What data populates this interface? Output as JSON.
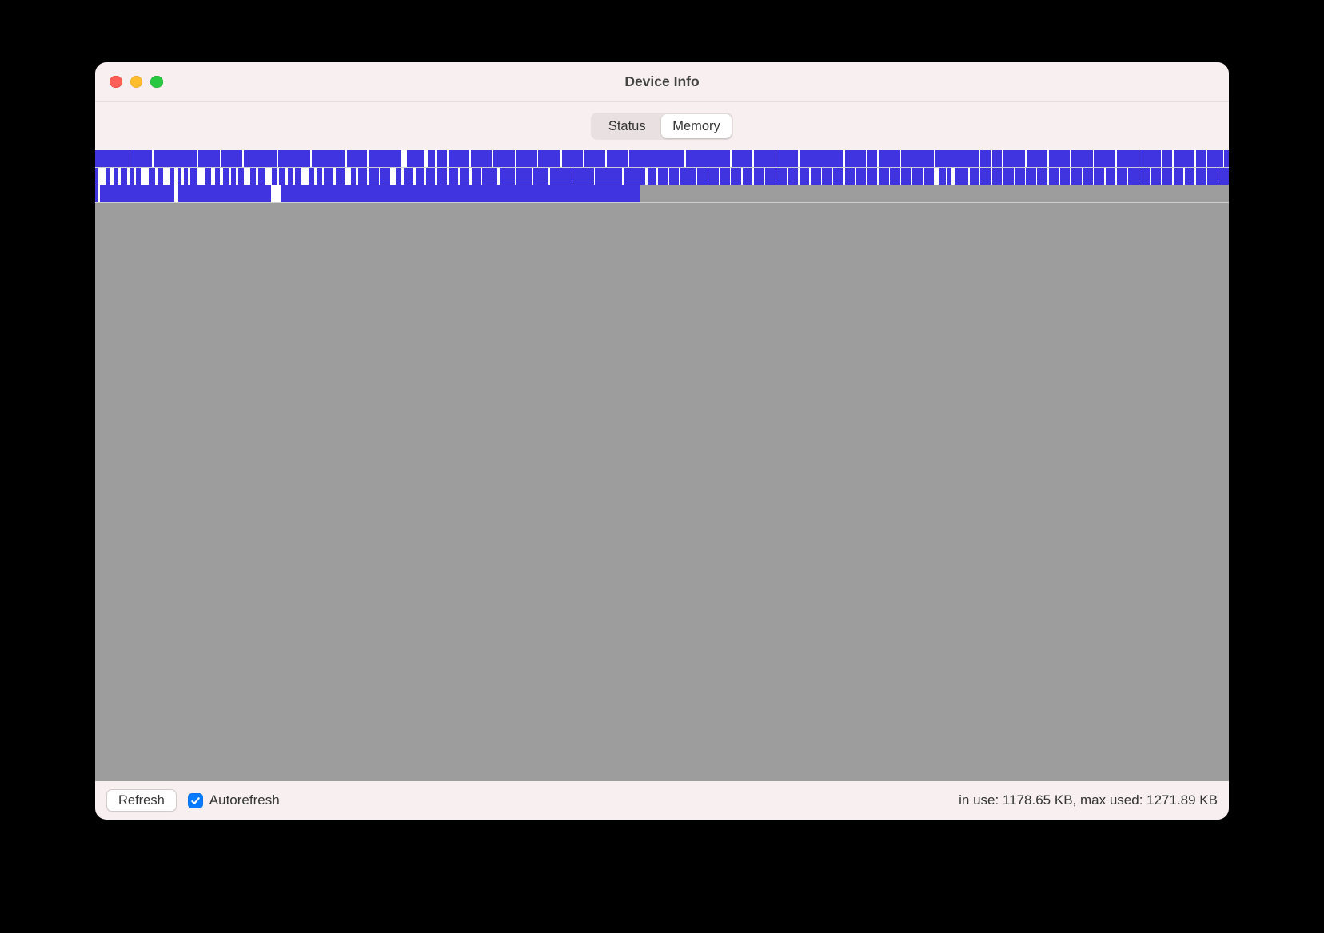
{
  "window": {
    "title": "Device Info"
  },
  "tabs": [
    {
      "label": "Status",
      "selected": false
    },
    {
      "label": "Memory",
      "selected": true
    }
  ],
  "footer": {
    "refresh_label": "Refresh",
    "autorefresh_label": "Autorefresh",
    "autorefresh_checked": true,
    "stats_text": "in use: 1178.65 KB, max used: 1271.89 KB",
    "in_use_kb": 1178.65,
    "max_used_kb": 1271.89
  },
  "memory_map": {
    "color_used": "#4033e0",
    "color_free": "#ffffff",
    "color_unmapped": "#9d9d9d",
    "rows": [
      {
        "fill_percent": 100,
        "filled": true,
        "gaps": [
          {
            "p": 3,
            "w": 0.12
          },
          {
            "p": 5,
            "w": 0.14
          },
          {
            "p": 9,
            "w": 0.1
          },
          {
            "p": 11,
            "w": 0.1
          },
          {
            "p": 13,
            "w": 0.12
          },
          {
            "p": 16,
            "w": 0.15
          },
          {
            "p": 19,
            "w": 0.12
          },
          {
            "p": 22,
            "w": 0.18
          },
          {
            "p": 24,
            "w": 0.1
          },
          {
            "p": 27,
            "w": 0.5
          },
          {
            "p": 29,
            "w": 0.35
          },
          {
            "p": 30,
            "w": 0.14
          },
          {
            "p": 31,
            "w": 0.18
          },
          {
            "p": 33,
            "w": 0.12
          },
          {
            "p": 35,
            "w": 0.12
          },
          {
            "p": 37,
            "w": 0.1
          },
          {
            "p": 39,
            "w": 0.1
          },
          {
            "p": 41,
            "w": 0.16
          },
          {
            "p": 43,
            "w": 0.14
          },
          {
            "p": 45,
            "w": 0.1
          },
          {
            "p": 47,
            "w": 0.12
          },
          {
            "p": 52,
            "w": 0.1
          },
          {
            "p": 56,
            "w": 0.16
          },
          {
            "p": 58,
            "w": 0.1
          },
          {
            "p": 60,
            "w": 0.1
          },
          {
            "p": 62,
            "w": 0.12
          },
          {
            "p": 66,
            "w": 0.12
          },
          {
            "p": 68,
            "w": 0.1
          },
          {
            "p": 69,
            "w": 0.12
          },
          {
            "p": 71,
            "w": 0.1
          },
          {
            "p": 74,
            "w": 0.1
          },
          {
            "p": 78,
            "w": 0.1
          },
          {
            "p": 79,
            "w": 0.1
          },
          {
            "p": 80,
            "w": 0.1
          },
          {
            "p": 82,
            "w": 0.15
          },
          {
            "p": 84,
            "w": 0.12
          },
          {
            "p": 86,
            "w": 0.12
          },
          {
            "p": 88,
            "w": 0.1
          },
          {
            "p": 90,
            "w": 0.1
          },
          {
            "p": 92,
            "w": 0.1
          },
          {
            "p": 94,
            "w": 0.12
          },
          {
            "p": 95,
            "w": 0.1
          },
          {
            "p": 97,
            "w": 0.12
          },
          {
            "p": 98,
            "w": 0.12
          },
          {
            "p": 99.5,
            "w": 0.1
          }
        ]
      },
      {
        "fill_percent": 100,
        "filled": true,
        "gaps": [
          {
            "p": 0.3,
            "w": 0.6
          },
          {
            "p": 1.3,
            "w": 0.3
          },
          {
            "p": 2,
            "w": 0.25
          },
          {
            "p": 2.8,
            "w": 0.2
          },
          {
            "p": 3.4,
            "w": 0.18
          },
          {
            "p": 4.0,
            "w": 0.7
          },
          {
            "p": 5.3,
            "w": 0.25
          },
          {
            "p": 6.0,
            "w": 0.6
          },
          {
            "p": 7.0,
            "w": 0.3
          },
          {
            "p": 7.6,
            "w": 0.2
          },
          {
            "p": 8.2,
            "w": 0.2
          },
          {
            "p": 9.0,
            "w": 0.7
          },
          {
            "p": 10.2,
            "w": 0.4
          },
          {
            "p": 11.0,
            "w": 0.25
          },
          {
            "p": 11.8,
            "w": 0.2
          },
          {
            "p": 12.4,
            "w": 0.2
          },
          {
            "p": 13.1,
            "w": 0.6
          },
          {
            "p": 14.2,
            "w": 0.2
          },
          {
            "p": 15.0,
            "w": 0.6
          },
          {
            "p": 16.0,
            "w": 0.25
          },
          {
            "p": 16.8,
            "w": 0.2
          },
          {
            "p": 17.4,
            "w": 0.2
          },
          {
            "p": 18.2,
            "w": 0.6
          },
          {
            "p": 19.3,
            "w": 0.2
          },
          {
            "p": 20.0,
            "w": 0.2
          },
          {
            "p": 21.0,
            "w": 0.25
          },
          {
            "p": 22.0,
            "w": 0.6
          },
          {
            "p": 23.0,
            "w": 0.2
          },
          {
            "p": 24.0,
            "w": 0.2
          },
          {
            "p": 25.0,
            "w": 0.14
          },
          {
            "p": 26.0,
            "w": 0.5
          },
          {
            "p": 27.0,
            "w": 0.2
          },
          {
            "p": 28.0,
            "w": 0.25
          },
          {
            "p": 29.0,
            "w": 0.2
          },
          {
            "p": 30.0,
            "w": 0.2
          },
          {
            "p": 31.0,
            "w": 0.2
          },
          {
            "p": 32.0,
            "w": 0.18
          },
          {
            "p": 33.0,
            "w": 0.2
          },
          {
            "p": 34.0,
            "w": 0.15
          },
          {
            "p": 35.5,
            "w": 0.15
          },
          {
            "p": 37.0,
            "w": 0.12
          },
          {
            "p": 38.5,
            "w": 0.12
          },
          {
            "p": 40.0,
            "w": 0.1
          },
          {
            "p": 42.0,
            "w": 0.12
          },
          {
            "p": 44.0,
            "w": 0.1
          },
          {
            "p": 46.5,
            "w": 0.1
          },
          {
            "p": 48.5,
            "w": 0.25
          },
          {
            "p": 49.5,
            "w": 0.12
          },
          {
            "p": 50.5,
            "w": 0.12
          },
          {
            "p": 51.5,
            "w": 0.12
          },
          {
            "p": 53.0,
            "w": 0.12
          },
          {
            "p": 54.0,
            "w": 0.1
          },
          {
            "p": 55.0,
            "w": 0.12
          },
          {
            "p": 56.0,
            "w": 0.1
          },
          {
            "p": 57.0,
            "w": 0.12
          },
          {
            "p": 58.0,
            "w": 0.1
          },
          {
            "p": 59.0,
            "w": 0.1
          },
          {
            "p": 60.0,
            "w": 0.12
          },
          {
            "p": 61.0,
            "w": 0.12
          },
          {
            "p": 62.0,
            "w": 0.1
          },
          {
            "p": 63.0,
            "w": 0.12
          },
          {
            "p": 64.0,
            "w": 0.12
          },
          {
            "p": 65.0,
            "w": 0.1
          },
          {
            "p": 66.0,
            "w": 0.12
          },
          {
            "p": 67.0,
            "w": 0.12
          },
          {
            "p": 68.0,
            "w": 0.12
          },
          {
            "p": 69.0,
            "w": 0.1
          },
          {
            "p": 70.0,
            "w": 0.1
          },
          {
            "p": 71.0,
            "w": 0.12
          },
          {
            "p": 72.0,
            "w": 0.1
          },
          {
            "p": 73.0,
            "w": 0.12
          },
          {
            "p": 74.0,
            "w": 0.4
          },
          {
            "p": 75.0,
            "w": 0.1
          },
          {
            "p": 75.5,
            "w": 0.3
          },
          {
            "p": 77.0,
            "w": 0.12
          },
          {
            "p": 78.0,
            "w": 0.1
          },
          {
            "p": 79.0,
            "w": 0.1
          },
          {
            "p": 80.0,
            "w": 0.12
          },
          {
            "p": 81.0,
            "w": 0.12
          },
          {
            "p": 82.0,
            "w": 0.12
          },
          {
            "p": 83.0,
            "w": 0.1
          },
          {
            "p": 84.0,
            "w": 0.12
          },
          {
            "p": 85.0,
            "w": 0.1
          },
          {
            "p": 86.0,
            "w": 0.12
          },
          {
            "p": 87.0,
            "w": 0.1
          },
          {
            "p": 88.0,
            "w": 0.1
          },
          {
            "p": 89.0,
            "w": 0.12
          },
          {
            "p": 90.0,
            "w": 0.1
          },
          {
            "p": 91.0,
            "w": 0.12
          },
          {
            "p": 92.0,
            "w": 0.1
          },
          {
            "p": 93.0,
            "w": 0.1
          },
          {
            "p": 94.0,
            "w": 0.1
          },
          {
            "p": 95.0,
            "w": 0.1
          },
          {
            "p": 96.0,
            "w": 0.1
          },
          {
            "p": 97.0,
            "w": 0.1
          },
          {
            "p": 98.0,
            "w": 0.1
          },
          {
            "p": 99.0,
            "w": 0.1
          }
        ]
      },
      {
        "fill_percent": 48,
        "filled": true,
        "gaps": [
          {
            "p": 0.3,
            "w": 0.15
          },
          {
            "p": 7.0,
            "w": 0.35
          },
          {
            "p": 15.5,
            "w": 0.9
          }
        ]
      }
    ]
  }
}
